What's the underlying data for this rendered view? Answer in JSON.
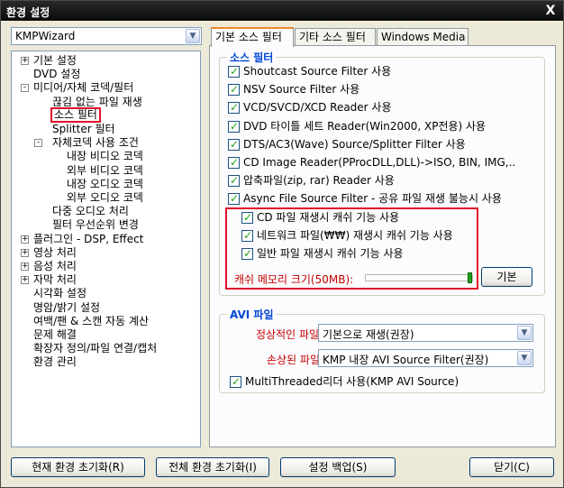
{
  "window": {
    "title": "환경 설정",
    "close_label": "X"
  },
  "profile": {
    "value": "KMPWizard"
  },
  "tree": {
    "items": [
      {
        "label": "기본 설정",
        "level": 0,
        "expander": "+"
      },
      {
        "label": "DVD 설정",
        "level": 0,
        "expander": ""
      },
      {
        "label": "미디어/자체 코덱/필터",
        "level": 0,
        "expander": "-"
      },
      {
        "label": "끊김 없는 파일 재생",
        "level": 1,
        "expander": ""
      },
      {
        "label": "소스 필터",
        "level": 1,
        "expander": ""
      },
      {
        "label": "Splitter 필터",
        "level": 1,
        "expander": ""
      },
      {
        "label": "자체코덱 사용 조건",
        "level": 1,
        "expander": "-"
      },
      {
        "label": "내장 비디오 코덱",
        "level": 2,
        "expander": ""
      },
      {
        "label": "외부 비디오 코덱",
        "level": 2,
        "expander": ""
      },
      {
        "label": "내장 오디오 코덱",
        "level": 2,
        "expander": ""
      },
      {
        "label": "외부 오디오 코덱",
        "level": 2,
        "expander": ""
      },
      {
        "label": "다중 오디오 처리",
        "level": 1,
        "expander": ""
      },
      {
        "label": "필터 우선순위 변경",
        "level": 1,
        "expander": ""
      },
      {
        "label": "플러그인 - DSP, Effect",
        "level": 0,
        "expander": "+"
      },
      {
        "label": "영상 처리",
        "level": 0,
        "expander": "+"
      },
      {
        "label": "음성 처리",
        "level": 0,
        "expander": "+"
      },
      {
        "label": "자막 처리",
        "level": 0,
        "expander": "+"
      },
      {
        "label": "시각화 설정",
        "level": 0,
        "expander": ""
      },
      {
        "label": "명암/밝기 설정",
        "level": 0,
        "expander": ""
      },
      {
        "label": "여백/팬 & 스캔 자동 계산",
        "level": 0,
        "expander": ""
      },
      {
        "label": "문제 해결",
        "level": 0,
        "expander": ""
      },
      {
        "label": "확장자 정의/파일 연결/캡처",
        "level": 0,
        "expander": ""
      },
      {
        "label": "환경 관리",
        "level": 0,
        "expander": ""
      }
    ],
    "selected_index": 4
  },
  "tabs": [
    {
      "label": "기본 소스 필터"
    },
    {
      "label": "기타 소스 필터"
    },
    {
      "label": "Windows Media"
    }
  ],
  "source_filter": {
    "title": "소스 필터",
    "checks": [
      {
        "label": "Shoutcast Source Filter 사용",
        "checked": true
      },
      {
        "label": "NSV Source Filter 사용",
        "checked": true
      },
      {
        "label": "VCD/SVCD/XCD Reader 사용",
        "checked": true
      },
      {
        "label": "DVD 타이틀 세트 Reader(Win2000, XP전용) 사용",
        "checked": true
      },
      {
        "label": "DTS/AC3(Wave) Source/Splitter Filter 사용",
        "checked": true
      },
      {
        "label": "CD Image Reader(PProcDLL,DLL)->ISO, BIN, IMG,..",
        "checked": true
      },
      {
        "label": "압축파일(zip, rar) Reader 사용",
        "checked": true
      },
      {
        "label": "Async File Source Filter - 공유 파일 재생 불능시 사용",
        "checked": true
      }
    ],
    "cache_checks": [
      {
        "label": "CD 파일 재생시 캐쉬 기능 사용",
        "checked": true
      },
      {
        "label": "네트워크 파일(₩₩) 재생시 캐쉬 기능 사용",
        "checked": true
      },
      {
        "label": "일반 파일 재생시 캐쉬 기능 사용",
        "checked": true
      }
    ],
    "cache_size_label": "캐쉬 메모리 크기(50MB):",
    "cache_level": 1.0,
    "default_button": "기본"
  },
  "avi": {
    "title": "AVI 파일",
    "normal_label": "정상적인 파일:",
    "normal_value": "기본으로 재생(권장)",
    "broken_label": "손상된 파일:",
    "broken_value": "KMP 내장 AVI Source Filter(권장)",
    "multithread_label": "MultiThreaded리더 사용(KMP AVI Source)",
    "multithread_checked": true
  },
  "buttons": {
    "reset_current": "현재 환경 초기화(R)",
    "reset_all": "전체 환경 초기화(I)",
    "backup": "설정 백업(S)",
    "close": "닫기(C)"
  },
  "colors": {
    "highlight": "#e0112b",
    "group_title": "#0046d5",
    "label_red": "#c40000"
  }
}
